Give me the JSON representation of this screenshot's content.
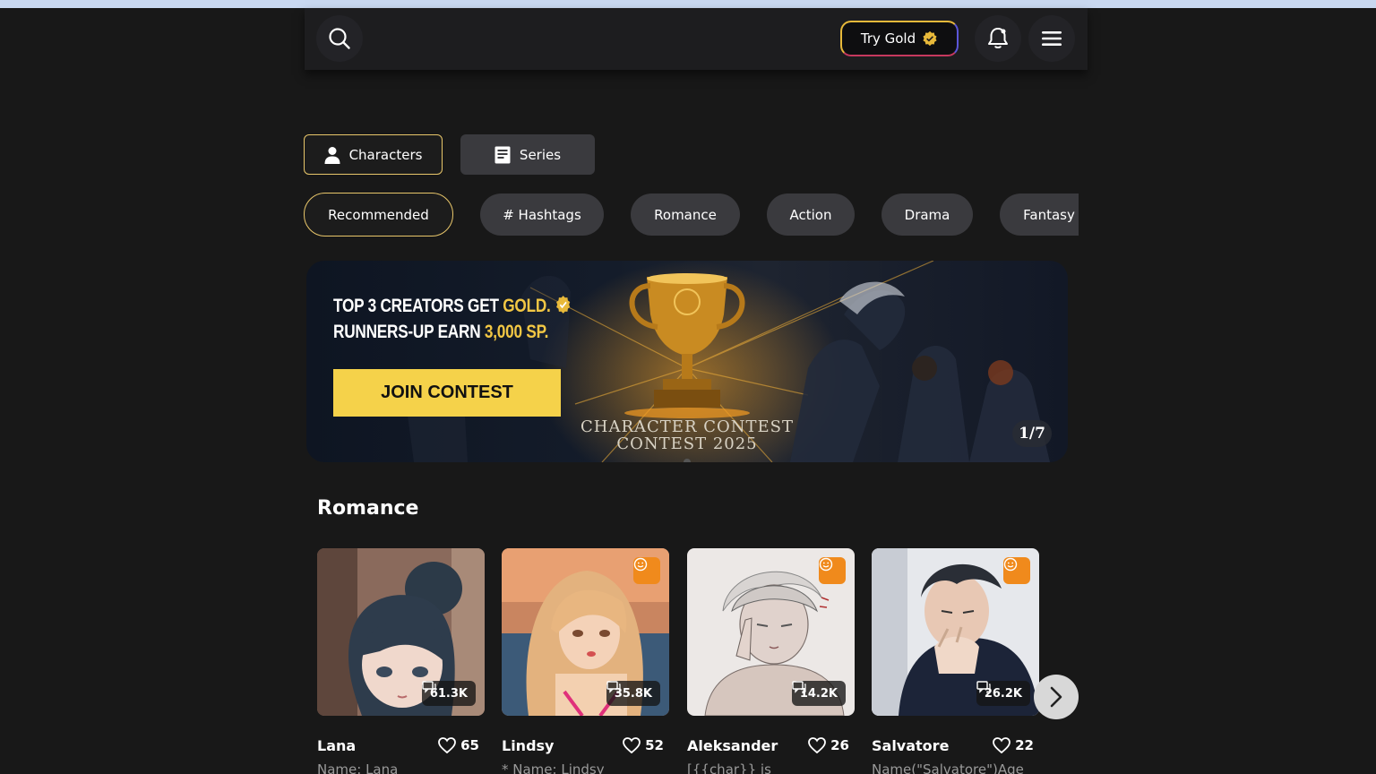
{
  "header": {
    "try_gold_label": "Try Gold",
    "icons": {
      "search": "search-icon",
      "gold_badge": "verified-badge-icon",
      "notifications": "bell-icon",
      "menu": "hamburger-menu-icon"
    }
  },
  "type_tabs": [
    {
      "label": "Characters",
      "icon": "person-icon",
      "active": true
    },
    {
      "label": "Series",
      "icon": "book-icon",
      "active": false
    }
  ],
  "chips": [
    {
      "label": "Recommended",
      "active": true
    },
    {
      "label": "# Hashtags",
      "active": false
    },
    {
      "label": "Romance",
      "active": false
    },
    {
      "label": "Action",
      "active": false
    },
    {
      "label": "Drama",
      "active": false
    },
    {
      "label": "Fantasy",
      "active": false
    }
  ],
  "banner": {
    "line1_a": "TOP 3 CREATORS GET",
    "line1_b": "GOLD.",
    "line2_a": "RUNNERS-UP EARN",
    "line2_b": "3,000 SP.",
    "join_label": "JOIN CONTEST",
    "contest_line1": "CHARACTER CONTEST",
    "contest_line2": "CONTEST 2025",
    "pager": "1/7"
  },
  "section": {
    "title": "Romance",
    "cards": [
      {
        "name": "Lana",
        "likes": "65",
        "chats": "61.3K",
        "desc": "Name: Lana",
        "badge": false
      },
      {
        "name": "Lindsy",
        "likes": "52",
        "chats": "35.8K",
        "desc": "* Name: Lindsy",
        "badge": true
      },
      {
        "name": "Aleksander",
        "likes": "26",
        "chats": "14.2K",
        "desc": "[{{char}} is",
        "badge": true
      },
      {
        "name": "Salvatore",
        "likes": "22",
        "chats": "26.2K",
        "desc": "Name(\"Salvatore\")Age",
        "badge": true
      }
    ]
  },
  "colors": {
    "accent_gold": "#e8c66a",
    "badge_orange": "#f08a1c",
    "join_yellow": "#f5d24a"
  }
}
